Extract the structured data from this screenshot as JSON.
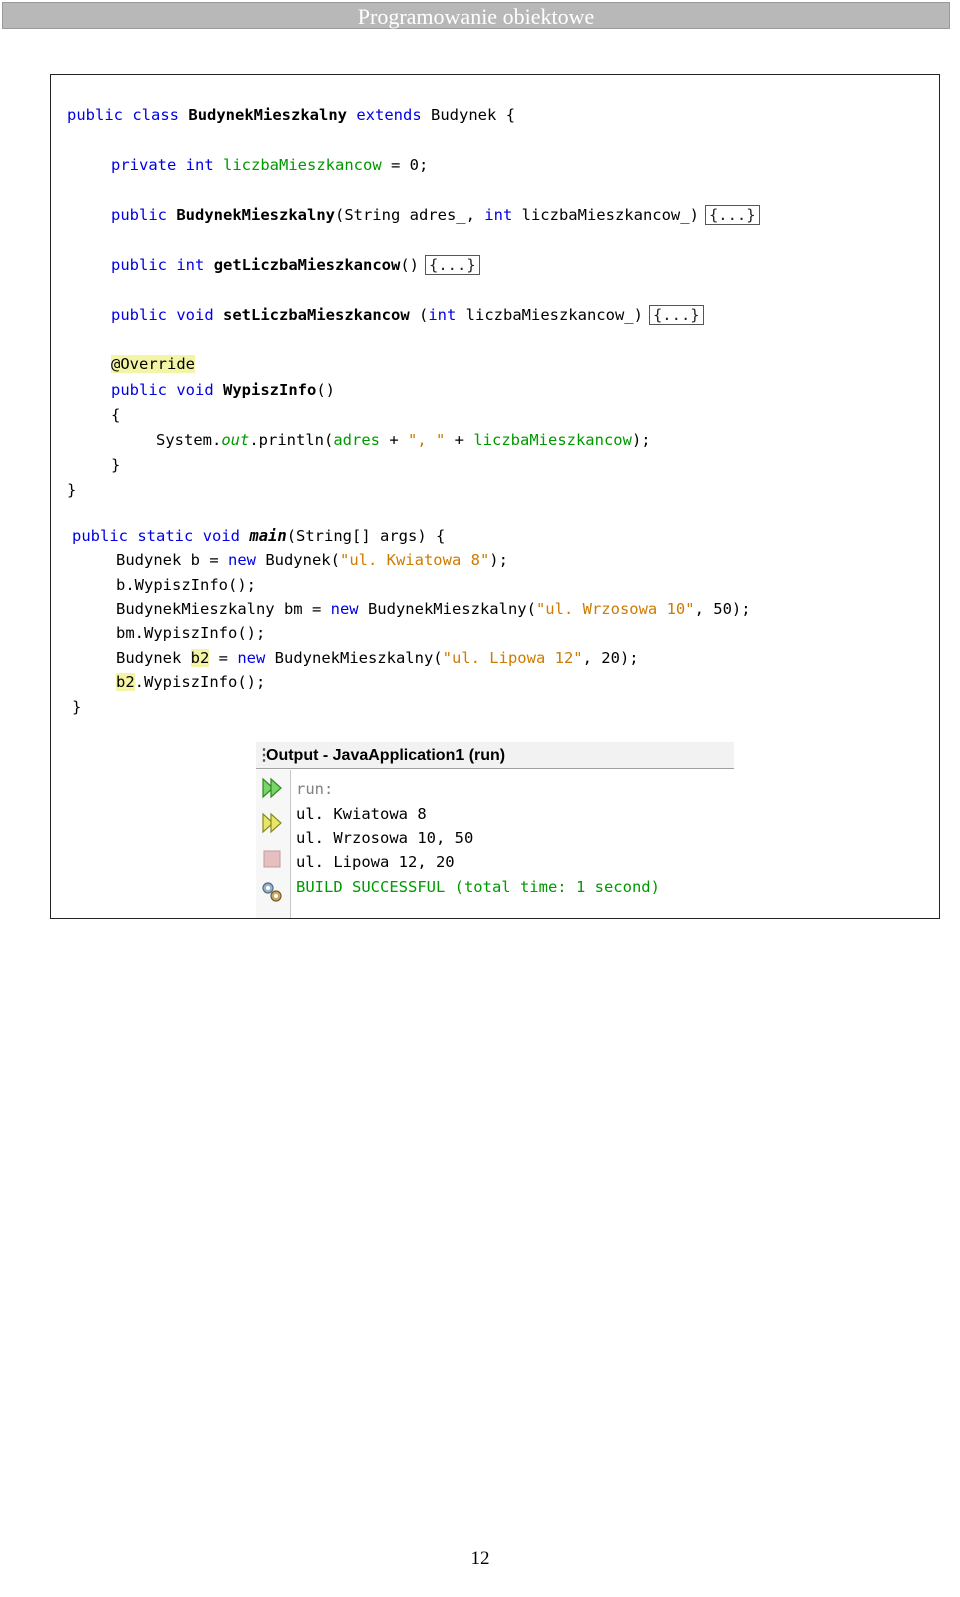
{
  "header": {
    "title": "Programowanie obiektowe"
  },
  "code": {
    "l1": {
      "kw1": "public",
      "kw2": "class",
      "name": "BudynekMieszkalny",
      "kw3": "extends",
      "base": "Budynek",
      "brace": "{"
    },
    "l2": {
      "kw1": "private",
      "kw2": "int",
      "field": "liczbaMieszkancow",
      "rest": " = 0;"
    },
    "l3": {
      "kw1": "public",
      "name": "BudynekMieszkalny",
      "p1": "(String adres_, ",
      "kw2": "int",
      "p2": " liczbaMieszkancow_)",
      "fold": "{...}"
    },
    "l4": {
      "kw1": "public",
      "kw2": "int",
      "name": "getLiczbaMieszkancow",
      "p": "()",
      "fold": "{...}"
    },
    "l5": {
      "kw1": "public",
      "kw2": "void",
      "name": "setLiczbaMieszkancow",
      "p1": " (",
      "kw3": "int",
      "p2": " liczbaMieszkancow_)",
      "fold": "{...}"
    },
    "l6": {
      "anno": "@Override"
    },
    "l7": {
      "kw1": "public",
      "kw2": "void",
      "name": "WypiszInfo",
      "p": "()"
    },
    "l8": {
      "brace": "{"
    },
    "l9": {
      "a": "System.",
      "b": "out",
      "c": ".println(",
      "d": "adres",
      "e": " + ",
      "f": "\", \"",
      "g": " + ",
      "h": "liczbaMieszkancow",
      "i": ");"
    },
    "l10": {
      "brace": "}"
    },
    "l11": {
      "brace": "}"
    },
    "m1": {
      "kw1": "public",
      "kw2": "static",
      "kw3": "void",
      "name": "main",
      "rest": "(String[] args) {"
    },
    "m2": {
      "a": "Budynek b = ",
      "kw": "new",
      "b": " Budynek(",
      "s": "\"ul. Kwiatowa 8\"",
      "c": ");"
    },
    "m3": {
      "a": "b.WypiszInfo();"
    },
    "m4": {
      "a": "BudynekMieszkalny bm = ",
      "kw": "new",
      "b": " BudynekMieszkalny(",
      "s": "\"ul. Wrzosowa 10\"",
      "c": ", 50);"
    },
    "m5": {
      "a": "bm.WypiszInfo();"
    },
    "m6": {
      "a": "Budynek ",
      "v": "b2",
      "b": " = ",
      "kw": "new",
      "c": " BudynekMieszkalny(",
      "s": "\"ul. Lipowa 12\"",
      "d": ", 20);"
    },
    "m7": {
      "v": "b2",
      "a": ".WypiszInfo();"
    },
    "m8": {
      "brace": "}"
    }
  },
  "output": {
    "title": "Output - JavaApplication1 (run)",
    "lines": [
      "run:",
      "ul. Kwiatowa 8",
      "ul. Wrzosowa 10, 50",
      "ul. Lipowa 12, 20",
      "BUILD SUCCESSFUL (total time: 1 second)"
    ],
    "icons": [
      "rerun-icon",
      "rerun-with-options-icon",
      "stop-icon",
      "settings-icon"
    ]
  },
  "footer": {
    "page_number": "12"
  }
}
